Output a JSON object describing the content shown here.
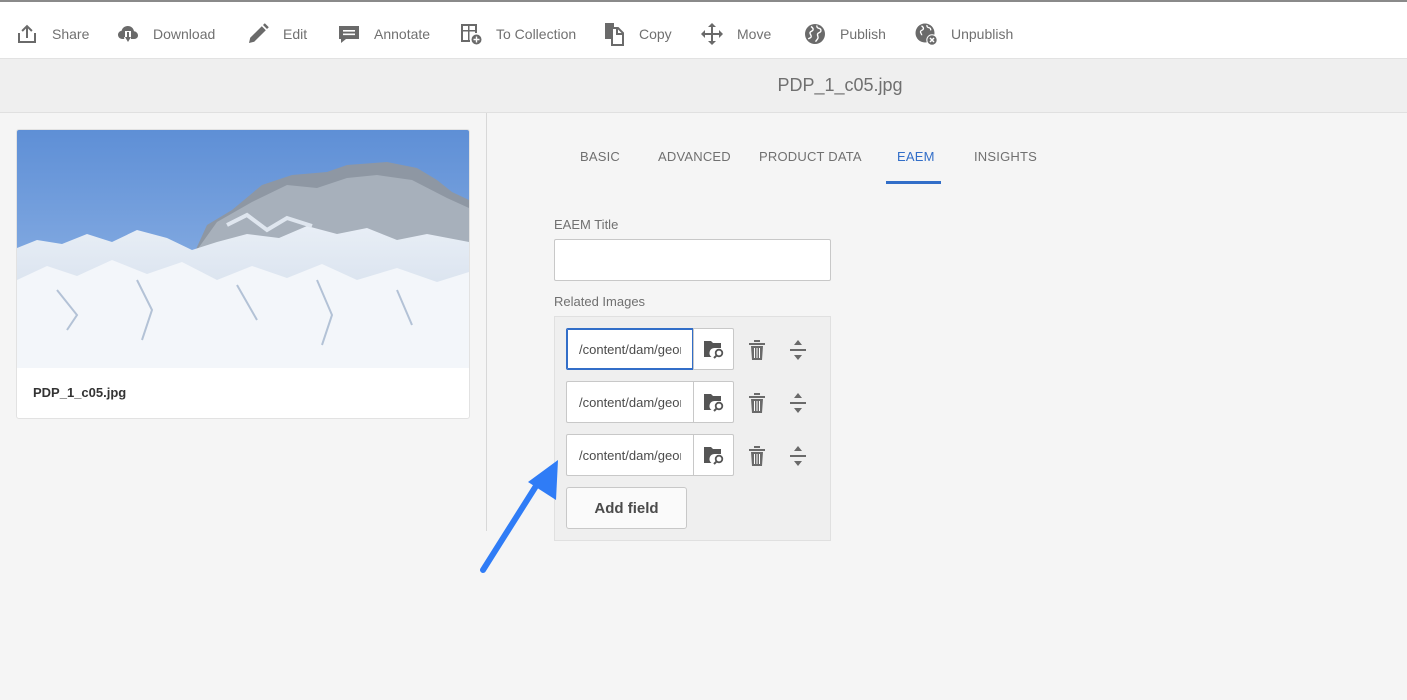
{
  "toolbar": {
    "items": [
      {
        "label": "Share",
        "icon": "share-icon"
      },
      {
        "label": "Download",
        "icon": "cloud-download-icon"
      },
      {
        "label": "Edit",
        "icon": "pencil-icon"
      },
      {
        "label": "Annotate",
        "icon": "comment-icon"
      },
      {
        "label": "To Collection",
        "icon": "add-to-collection-icon"
      },
      {
        "label": "Copy",
        "icon": "copy-icon"
      },
      {
        "label": "Move",
        "icon": "move-icon"
      },
      {
        "label": "Publish",
        "icon": "globe-icon"
      },
      {
        "label": "Unpublish",
        "icon": "globe-remove-icon"
      }
    ]
  },
  "header": {
    "title": "PDP_1_c05.jpg"
  },
  "asset_card": {
    "title": "PDP_1_c05.jpg",
    "thumbnail": "snowy-mountain-image"
  },
  "tabs": [
    {
      "label": "BASIC",
      "active": false
    },
    {
      "label": "ADVANCED",
      "active": false
    },
    {
      "label": "PRODUCT DATA",
      "active": false
    },
    {
      "label": "EAEM",
      "active": true
    },
    {
      "label": "INSIGHTS",
      "active": false
    }
  ],
  "form": {
    "title_label": "EAEM Title",
    "title_value": "",
    "related_label": "Related Images",
    "related_values": [
      "/content/dam/geometrixx",
      "/content/dam/geometrixx",
      "/content/dam/geometrixx"
    ],
    "add_field_label": "Add field"
  },
  "colors": {
    "accent": "#326ec8",
    "arrow": "#2f7cf6"
  }
}
